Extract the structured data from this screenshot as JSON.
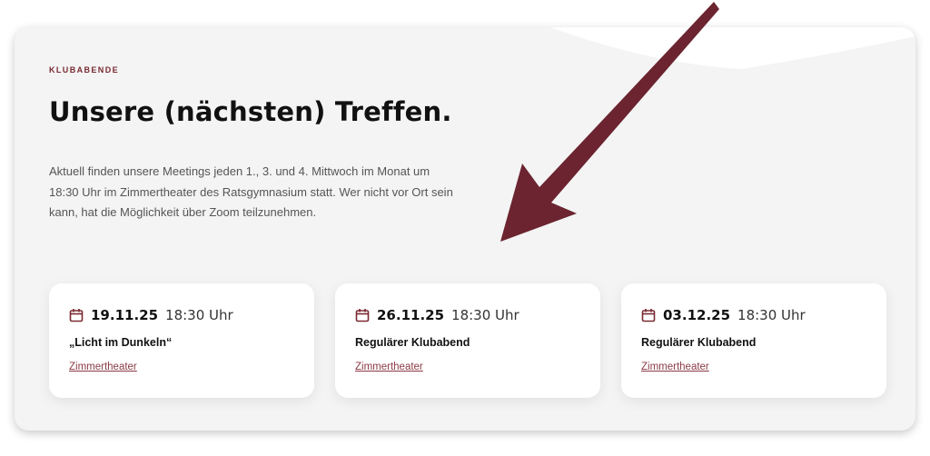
{
  "section": {
    "eyebrow": "KLUBABENDE",
    "title": "Unsere (nächsten) Treffen.",
    "description": "Aktuell finden unsere Meetings jeden 1., 3. und 4. Mittwoch im Monat um 18:30 Uhr im Zimmertheater des Ratsgymnasium statt. Wer nicht vor Ort sein kann, hat die Möglichkeit über Zoom teilzunehmen."
  },
  "events": [
    {
      "date": "19.11.25",
      "time": "18:30 Uhr",
      "title": "„Licht im Dunkeln“",
      "location": "Zimmertheater"
    },
    {
      "date": "26.11.25",
      "time": "18:30 Uhr",
      "title": "Regulärer Klubabend",
      "location": "Zimmertheater"
    },
    {
      "date": "03.12.25",
      "time": "18:30 Uhr",
      "title": "Regulärer Klubabend",
      "location": "Zimmertheater"
    }
  ],
  "icons": {
    "calendar": "calendar-icon",
    "annotation": "arrow-annotation"
  },
  "colors": {
    "accent": "#7a2a32",
    "arrow": "#6b2430",
    "panel": "#f4f4f4",
    "card": "#ffffff"
  }
}
